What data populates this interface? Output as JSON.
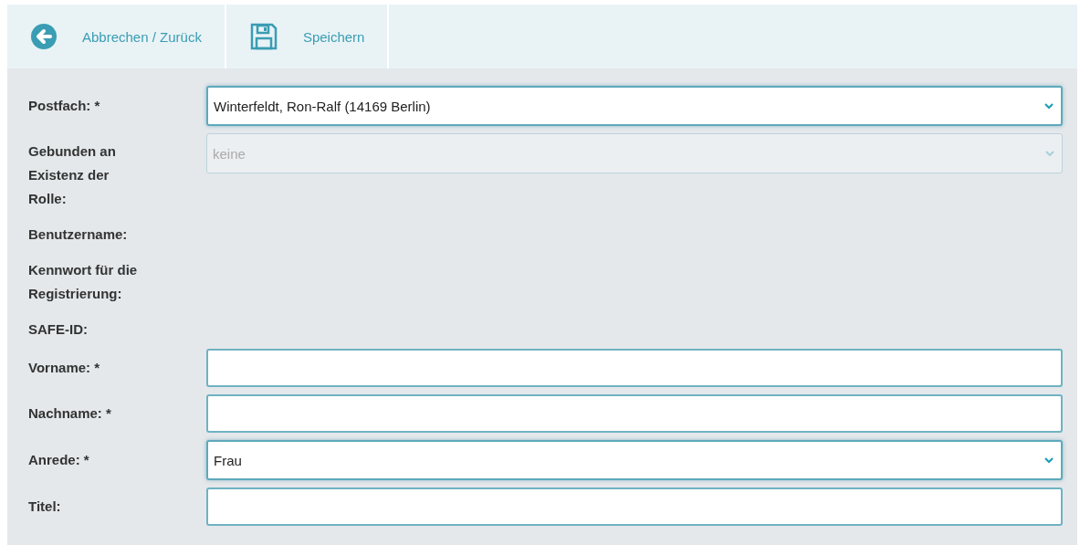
{
  "toolbar": [
    {
      "kind": "back",
      "label": "Abbrechen / Zurück"
    },
    {
      "kind": "save",
      "label": "Speichern"
    }
  ],
  "fields": [
    {
      "kind": "select",
      "label": "Postfach: *",
      "value": "Winterfeldt, Ron-Ralf (14169 Berlin)",
      "disabled": false
    },
    {
      "kind": "select",
      "label": "Gebunden an Existenz der Rolle:",
      "value": "keine",
      "disabled": true
    },
    {
      "kind": "text",
      "label": "Benutzername:"
    },
    {
      "kind": "text",
      "label": "Kennwort für die Registrierung:"
    },
    {
      "kind": "text",
      "label": "SAFE-ID:"
    },
    {
      "kind": "input",
      "label": "Vorname: *",
      "disabled": false
    },
    {
      "kind": "input",
      "label": "Nachname: *",
      "disabled": false
    },
    {
      "kind": "select",
      "label": "Anrede: *",
      "value": "Frau",
      "disabled": false
    },
    {
      "kind": "input",
      "label": "Titel:",
      "disabled": false
    }
  ]
}
